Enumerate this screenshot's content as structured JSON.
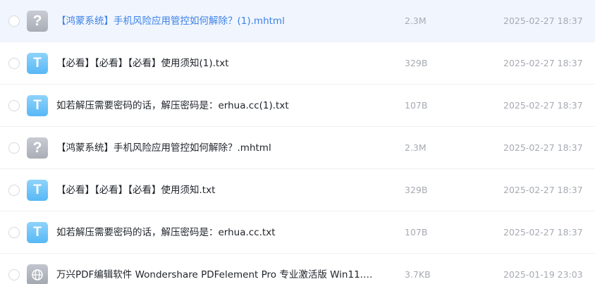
{
  "files": [
    {
      "icon": "unknown-file-icon",
      "icon_glyph": "?",
      "name": "【鸿蒙系统】手机风险应用管控如何解除？(1).mhtml",
      "size": "2.3M",
      "date": "2025-02-27 18:37"
    },
    {
      "icon": "text-file-icon",
      "icon_glyph": "T",
      "name": "【必看】【必看】【必看】使用须知(1).txt",
      "size": "329B",
      "date": "2025-02-27 18:37"
    },
    {
      "icon": "text-file-icon",
      "icon_glyph": "T",
      "name": "如若解压需要密码的话，解压密码是：erhua.cc(1).txt",
      "size": "107B",
      "date": "2025-02-27 18:37"
    },
    {
      "icon": "unknown-file-icon",
      "icon_glyph": "?",
      "name": "【鸿蒙系统】手机风险应用管控如何解除？.mhtml",
      "size": "2.3M",
      "date": "2025-02-27 18:37"
    },
    {
      "icon": "text-file-icon",
      "icon_glyph": "T",
      "name": "【必看】【必看】【必看】使用须知.txt",
      "size": "329B",
      "date": "2025-02-27 18:37"
    },
    {
      "icon": "text-file-icon",
      "icon_glyph": "T",
      "name": "如若解压需要密码的话，解压密码是：erhua.cc.txt",
      "size": "107B",
      "date": "2025-02-27 18:37"
    },
    {
      "icon": "link-file-icon",
      "icon_glyph": "",
      "name": "万兴PDF编辑软件 Wondershare PDFelement Pro 专业激活版 Win11.…",
      "size": "3.7KB",
      "date": "2025-01-19 23:03"
    }
  ],
  "colors": {
    "hover_row_bg": "#f1f5fd",
    "hover_name": "#3b82e8",
    "meta_text": "#a6aab2",
    "txt_icon": "#57b8f5",
    "unknown_icon": "#a9adb6"
  }
}
